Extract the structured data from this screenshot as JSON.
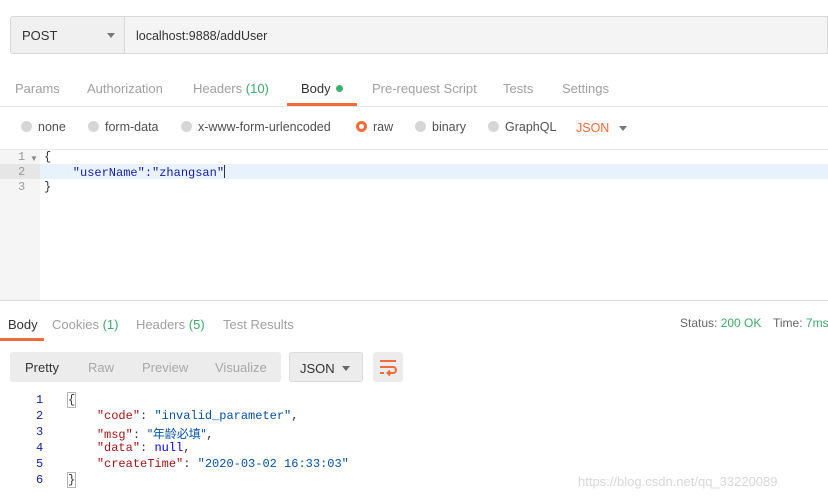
{
  "request": {
    "method": "POST",
    "url": "localhost:9888/addUser"
  },
  "request_tabs": [
    {
      "label": "Params"
    },
    {
      "label": "Authorization"
    },
    {
      "label": "Headers",
      "count": "(10)"
    },
    {
      "label": "Body"
    },
    {
      "label": "Pre-request Script"
    },
    {
      "label": "Tests"
    },
    {
      "label": "Settings"
    }
  ],
  "body_types": {
    "none": "none",
    "form_data": "form-data",
    "urlencoded": "x-www-form-urlencoded",
    "raw": "raw",
    "binary": "binary",
    "graphql": "GraphQL",
    "format": "JSON",
    "selected": "raw"
  },
  "request_body": {
    "line_numbers": [
      "1",
      "2",
      "3"
    ],
    "lines": [
      "{",
      "    \"userName\":\"zhangsan\"",
      "}"
    ]
  },
  "response_tabs": {
    "body": "Body",
    "cookies": "Cookies",
    "cookies_count": "(1)",
    "headers": "Headers",
    "headers_count": "(5)",
    "test_results": "Test Results"
  },
  "response_status": {
    "status_label": "Status:",
    "status_value": "200 OK",
    "time_label": "Time:",
    "time_value": "7ms"
  },
  "response_view": {
    "modes": [
      "Pretty",
      "Raw",
      "Preview",
      "Visualize"
    ],
    "active_mode": "Pretty",
    "format": "JSON"
  },
  "response_body": {
    "line_numbers": [
      "1",
      "2",
      "3",
      "4",
      "5",
      "6"
    ],
    "open": "{",
    "code_key": "\"code\"",
    "code_val": "\"invalid_parameter\"",
    "msg_key": "\"msg\"",
    "msg_val": "\"年龄必填\"",
    "data_key": "\"data\"",
    "data_val": "null",
    "time_key": "\"createTime\"",
    "time_val": "\"2020-03-02 16:33:03\"",
    "close": "}"
  },
  "watermark": "https://blog.csdn.net/qq_33220089",
  "colors": {
    "accent": "#f26b3a",
    "success": "#3fa86b"
  }
}
